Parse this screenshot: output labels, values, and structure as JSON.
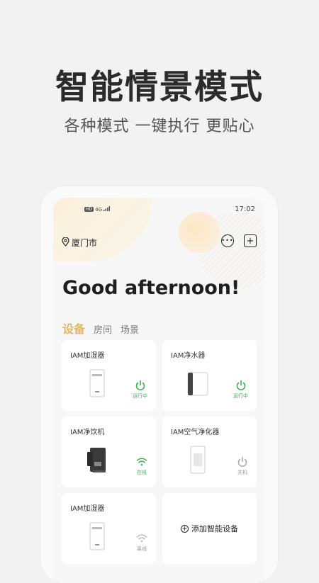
{
  "promo": {
    "title": "智能情景模式",
    "subtitle": "各种模式  一键执行 更贴心"
  },
  "status_bar": {
    "badge": "HD",
    "signal": "4G",
    "time": "17:02"
  },
  "header": {
    "location": "厦门市",
    "icons": [
      "location-pin-icon",
      "message-icon",
      "add-icon"
    ]
  },
  "greeting": "Good afternoon!",
  "tabs": [
    {
      "label": "设备",
      "active": true
    },
    {
      "label": "房间",
      "active": false
    },
    {
      "label": "场景",
      "active": false
    }
  ],
  "devices": [
    {
      "name": "IAM加湿器",
      "status": "运行中",
      "state": "on",
      "icon": "power-icon"
    },
    {
      "name": "IAM净水器",
      "status": "运行中",
      "state": "on",
      "icon": "power-icon"
    },
    {
      "name": "IAM净饮机",
      "status": "在线",
      "state": "on",
      "icon": "wifi-icon"
    },
    {
      "name": "IAM空气净化器",
      "status": "关机",
      "state": "off",
      "icon": "power-icon"
    },
    {
      "name": "IAM加湿器",
      "status": "离线",
      "state": "offline",
      "icon": "wifi-icon"
    }
  ],
  "add_device": {
    "label": "添加智能设备"
  },
  "colors": {
    "accent": "#e3b56b",
    "running": "#3bb54a",
    "idle": "#aaaaaa"
  }
}
